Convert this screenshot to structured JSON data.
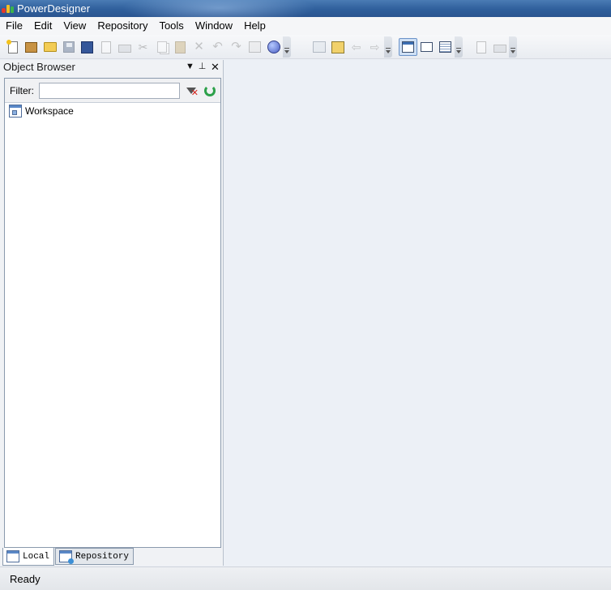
{
  "window": {
    "title": "PowerDesigner",
    "icon": "powerdesigner-app-icon"
  },
  "menu": [
    "File",
    "Edit",
    "View",
    "Repository",
    "Tools",
    "Window",
    "Help"
  ],
  "toolbar": {
    "groups": [
      [
        "new-icon",
        "new-project-icon",
        "open-icon",
        "save-icon",
        "save-all-icon",
        "print-preview-icon",
        "print-icon",
        "cut-icon",
        "copy-icon",
        "paste-icon",
        "delete-icon",
        "undo-icon",
        "redo-icon",
        "properties-icon",
        "check-model-icon"
      ],
      [
        "generate-icon",
        "reverse-engineer-icon",
        "previous-icon",
        "next-icon"
      ],
      [
        "object-browser-icon",
        "output-icon",
        "result-list-icon"
      ],
      [
        "print-preview-2-icon",
        "print-2-icon"
      ]
    ],
    "active": "object-browser-icon"
  },
  "object_browser": {
    "title": "Object Browser",
    "filter_label": "Filter:",
    "filter_value": "",
    "tree": [
      {
        "label": "Workspace",
        "icon": "workspace-icon"
      }
    ],
    "tabs": [
      {
        "label": "Local",
        "icon": "local-tab-icon",
        "active": true
      },
      {
        "label": "Repository",
        "icon": "repository-tab-icon",
        "active": false
      }
    ]
  },
  "status": {
    "text": "Ready"
  }
}
